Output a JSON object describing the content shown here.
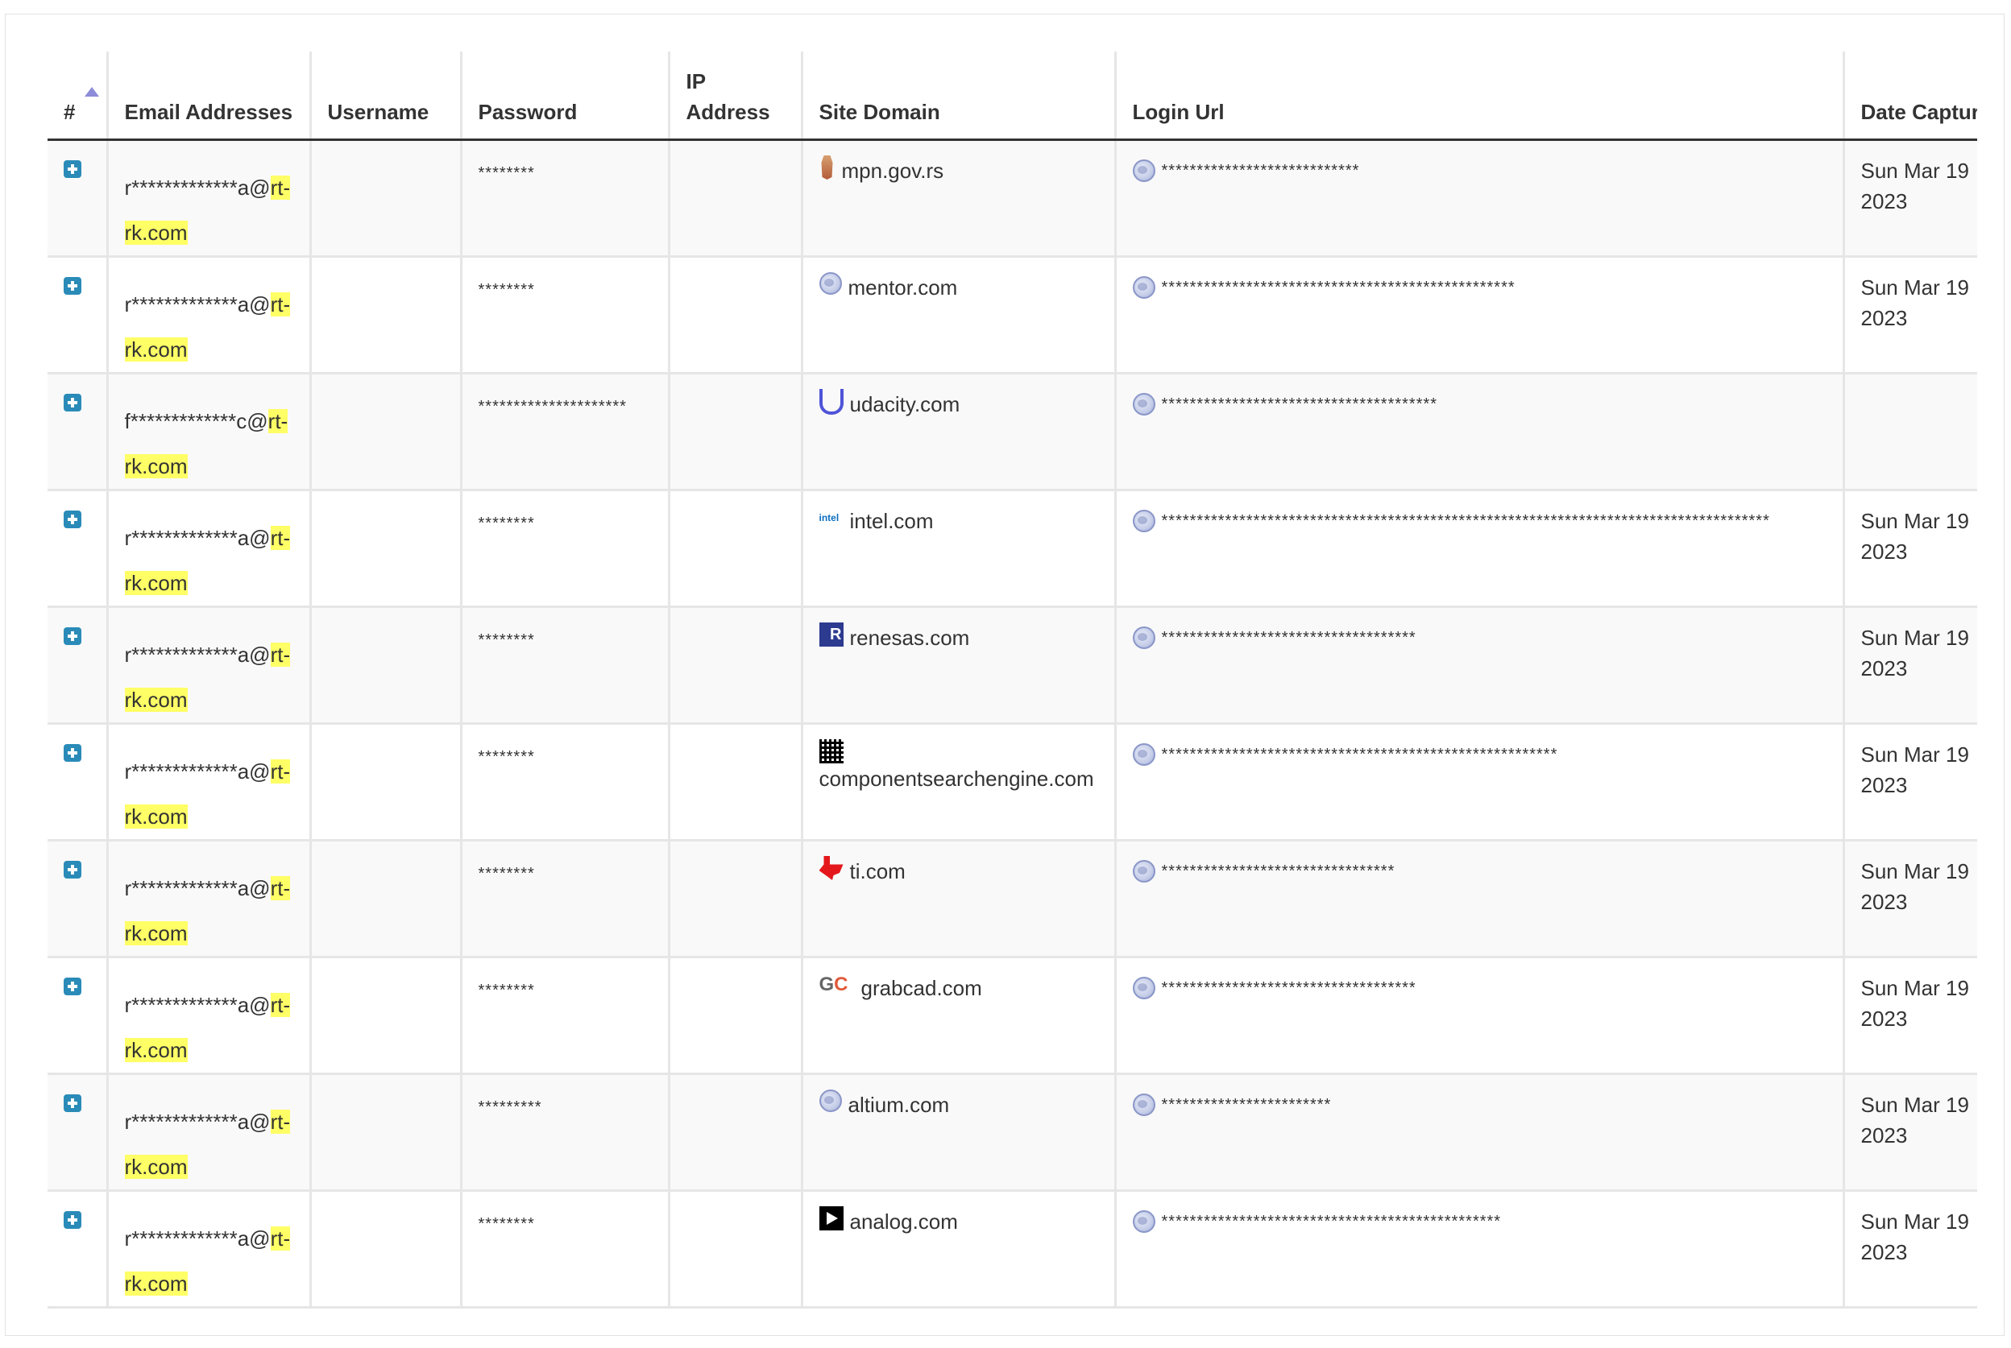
{
  "columns": {
    "num": "#",
    "email": "Email Addresses",
    "username": "Username",
    "password": "Password",
    "ip": "IP Address",
    "domain": "Site Domain",
    "login_url": "Login Url",
    "date": "Date Captured"
  },
  "sort": {
    "column": "#",
    "direction": "ascending"
  },
  "rows": [
    {
      "email_prefix": "r*************a@",
      "email_domain_a": "rt-",
      "email_domain_b": "rk.com",
      "username": "",
      "password": "********",
      "ip": "",
      "domain": "mpn.gov.rs",
      "favicon": "serbia-coat-of-arms-icon",
      "login_url": "****************************",
      "date": "Sun Mar 19 2023"
    },
    {
      "email_prefix": "r*************a@",
      "email_domain_a": "rt-",
      "email_domain_b": "rk.com",
      "username": "",
      "password": "********",
      "ip": "",
      "domain": "mentor.com",
      "favicon": "globe-icon",
      "login_url": "**************************************************",
      "date": "Sun Mar 19 2023"
    },
    {
      "email_prefix": "f*************c@",
      "email_domain_a": "rt-",
      "email_domain_b": "rk.com",
      "username": "",
      "password": "*********************",
      "ip": "",
      "domain": "udacity.com",
      "favicon": "udacity-logo-icon",
      "login_url": "***************************************",
      "date": ""
    },
    {
      "email_prefix": "r*************a@",
      "email_domain_a": "rt-",
      "email_domain_b": "rk.com",
      "username": "",
      "password": "********",
      "ip": "",
      "domain": "intel.com",
      "favicon": "intel-logo-icon",
      "login_url": "**************************************************************************************",
      "date": "Sun Mar 19 2023"
    },
    {
      "email_prefix": "r*************a@",
      "email_domain_a": "rt-",
      "email_domain_b": "rk.com",
      "username": "",
      "password": "********",
      "ip": "",
      "domain": "renesas.com",
      "favicon": "renesas-logo-icon",
      "login_url": "************************************",
      "date": "Sun Mar 19 2023"
    },
    {
      "email_prefix": "r*************a@",
      "email_domain_a": "rt-",
      "email_domain_b": "rk.com",
      "username": "",
      "password": "********",
      "ip": "",
      "domain": "componentsearchengine.com",
      "favicon": "componentsearchengine-logo-icon",
      "login_url": "********************************************************",
      "date": "Sun Mar 19 2023"
    },
    {
      "email_prefix": "r*************a@",
      "email_domain_a": "rt-",
      "email_domain_b": "rk.com",
      "username": "",
      "password": "********",
      "ip": "",
      "domain": "ti.com",
      "favicon": "texas-instruments-logo-icon",
      "login_url": "*********************************",
      "date": "Sun Mar 19 2023"
    },
    {
      "email_prefix": "r*************a@",
      "email_domain_a": "rt-",
      "email_domain_b": "rk.com",
      "username": "",
      "password": "********",
      "ip": "",
      "domain": "grabcad.com",
      "favicon": "grabcad-logo-icon",
      "login_url": "************************************",
      "date": "Sun Mar 19 2023"
    },
    {
      "email_prefix": "r*************a@",
      "email_domain_a": "rt-",
      "email_domain_b": "rk.com",
      "username": "",
      "password": "*********",
      "ip": "",
      "domain": "altium.com",
      "favicon": "globe-icon",
      "login_url": "************************",
      "date": "Sun Mar 19 2023"
    },
    {
      "email_prefix": "r*************a@",
      "email_domain_a": "rt-",
      "email_domain_b": "rk.com",
      "username": "",
      "password": "********",
      "ip": "",
      "domain": "analog.com",
      "favicon": "analog-devices-logo-icon",
      "login_url": "************************************************",
      "date": "Sun Mar 19 2023"
    }
  ],
  "colors": {
    "expand_button": "#2a8bb8",
    "highlight": "#ffff66",
    "sort_arrow": "#8c8cd8"
  }
}
